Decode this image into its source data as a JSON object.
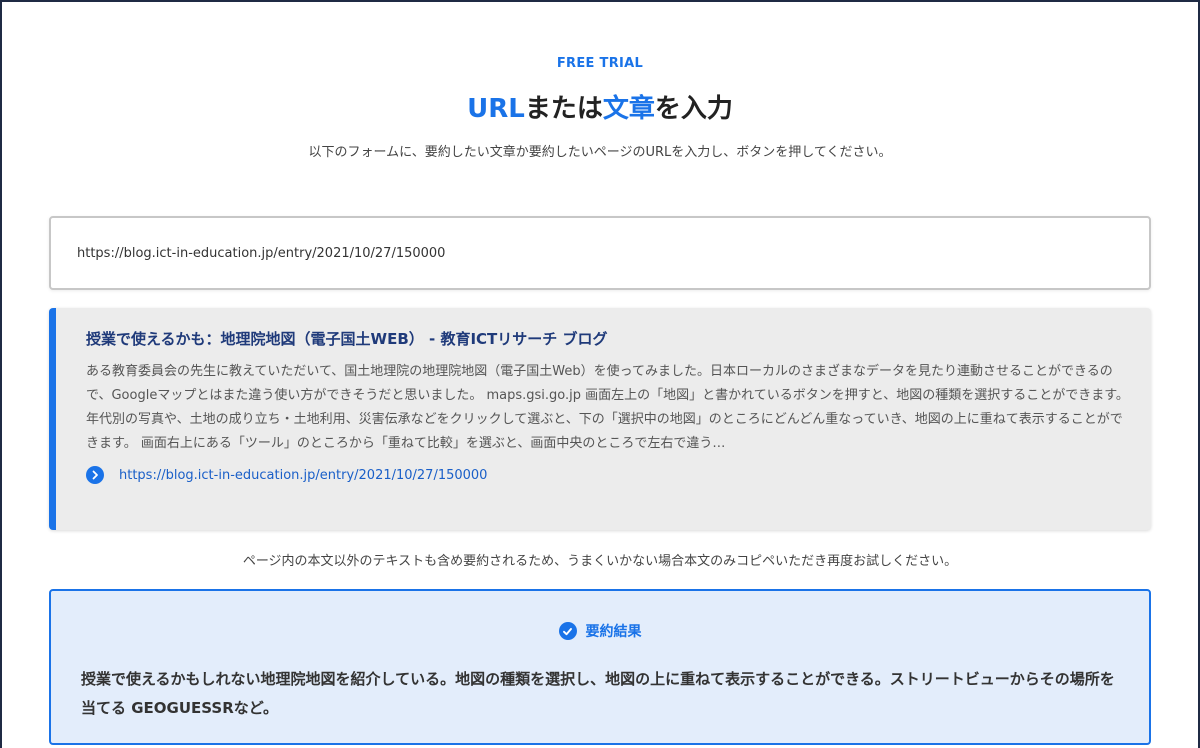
{
  "header": {
    "eyebrow": "FREE TRIAL",
    "title_parts": [
      "URL",
      "または",
      "文章",
      "を入力"
    ],
    "subtitle": "以下のフォームに、要約したい文章か要約したいページのURLを入力し、ボタンを押してください。"
  },
  "url_input": {
    "value": "https://blog.ict-in-education.jp/entry/2021/10/27/150000"
  },
  "preview": {
    "title": "授業で使えるかも：地理院地図（電子国土WEB） - 教育ICTリサーチ ブログ",
    "description": "ある教育委員会の先生に教えていただいて、国土地理院の地理院地図（電子国土Web）を使ってみました。日本ローカルのさまざまなデータを見たり連動させることができるので、Googleマップとはまた違う使い方ができそうだと思いました。 maps.gsi.go.jp 画面左上の「地図」と書かれているボタンを押すと、地図の種類を選択することができます。年代別の写真や、土地の成り立ち・土地利用、災害伝承などをクリックして選ぶと、下の「選択中の地図」のところにどんどん重なっていき、地図の上に重ねて表示することができます。 画面右上にある「ツール」のところから「重ねて比較」を選ぶと、画面中央のところで左右で違う…",
    "link": "https://blog.ict-in-education.jp/entry/2021/10/27/150000",
    "link_icon": "chevron-right-icon",
    "accent_color": "#1a73e8"
  },
  "notice": "ページ内の本文以外のテキストも含め要約されるため、うまくいかない場合本文のみコピペいただき再度お試しください。",
  "result": {
    "heading": "要約結果",
    "heading_icon": "check-circle-icon",
    "text": "授業で使えるかもしれない地理院地図を紹介している。地図の種類を選択し、地図の上に重ねて表示することができる。ストリートビューからその場所を当てる GEOGUESSRなど。"
  }
}
